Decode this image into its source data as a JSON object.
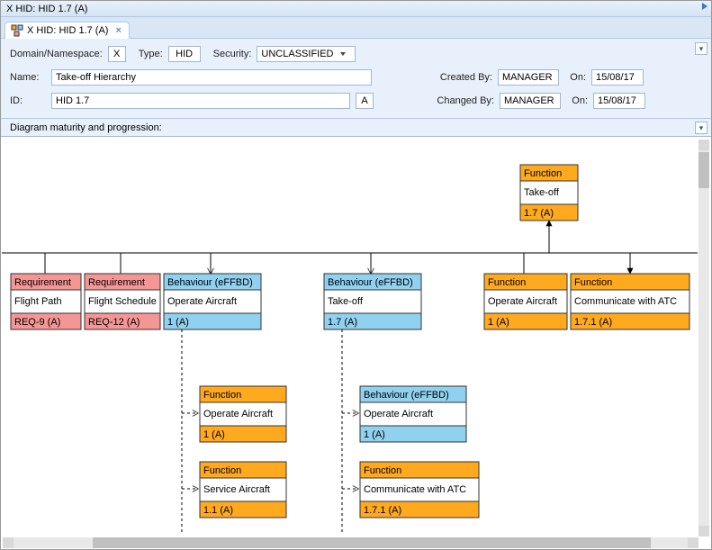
{
  "titlebar_title": "X HID: HID 1.7 (A)",
  "tab": {
    "label": "X HID: HID 1.7 (A)"
  },
  "form": {
    "domain_label": "Domain/Namespace:",
    "domain_value": "X",
    "type_label": "Type:",
    "type_value": "HID",
    "security_label": "Security:",
    "security_value": "UNCLASSIFIED",
    "name_label": "Name:",
    "name_value": "Take-off Hierarchy",
    "id_label": "ID:",
    "id_value": "HID 1.7",
    "id_suffix": "A",
    "created_by_label": "Created By:",
    "created_by_value": "MANAGER",
    "changed_by_label": "Changed By:",
    "changed_by_value": "MANAGER",
    "on_label": "On:",
    "created_on_value": "15/08/17",
    "changed_on_value": "15/08/17"
  },
  "maturity_label": "Diagram maturity and progression:",
  "colors": {
    "requirement": "#f49696",
    "behaviour": "#8fd1ee",
    "function": "#ffa91f"
  },
  "nodes": {
    "top_func": {
      "type": "Function",
      "name": "Take-off",
      "id": "1.7 (A)"
    },
    "req1": {
      "type": "Requirement",
      "name": "Flight Path",
      "id": "REQ-9 (A)"
    },
    "req2": {
      "type": "Requirement",
      "name": "Flight Schedule",
      "id": "REQ-12 (A)"
    },
    "beh1": {
      "type": "Behaviour (eFFBD)",
      "name": "Operate Aircraft",
      "id": "1 (A)"
    },
    "beh2": {
      "type": "Behaviour (eFFBD)",
      "name": "Take-off",
      "id": "1.7 (A)"
    },
    "func1": {
      "type": "Function",
      "name": "Operate Aircraft",
      "id": "1 (A)"
    },
    "func2": {
      "type": "Function",
      "name": "Communicate with ATC",
      "id": "1.7.1 (A)"
    },
    "sub1": {
      "type": "Function",
      "name": "Operate Aircraft",
      "id": "1 (A)"
    },
    "sub2": {
      "type": "Function",
      "name": "Service Aircraft",
      "id": "1.1 (A)"
    },
    "sub3": {
      "type": "Behaviour (eFFBD)",
      "name": "Operate Aircraft",
      "id": "1 (A)"
    },
    "sub4": {
      "type": "Function",
      "name": "Communicate with ATC",
      "id": "1.7.1 (A)"
    }
  }
}
